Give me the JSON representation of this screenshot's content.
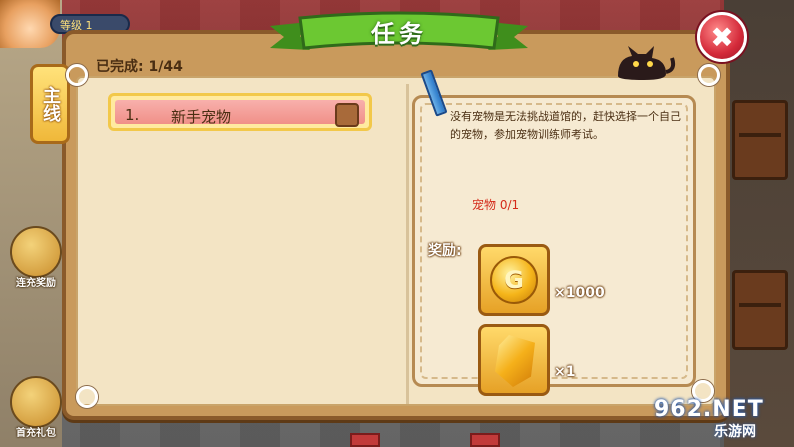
{
  "game": {
    "top_bar_text": "等级 1"
  },
  "dialog": {
    "title": "任务",
    "close_symbol": "✖",
    "completed_text": "已完成: 1/44",
    "main_tab_label": "主线"
  },
  "quests": [
    {
      "number": "1.",
      "name": "新手宠物",
      "selected": true
    }
  ],
  "detail": {
    "description": "没有宠物是无法挑战道馆的，赶快选择一个自己的宠物，参加宠物训练师考试。",
    "progress": "宠物 0/1",
    "reward_label": "奖励:",
    "rewards": [
      {
        "icon": "gold-coin-icon",
        "symbol": "G",
        "quantity": "×1000"
      },
      {
        "icon": "topaz-gem-icon",
        "quantity": "×1"
      }
    ]
  },
  "side_buttons": [
    {
      "label": "连充奖励",
      "icon": "treasure-pile-icon"
    },
    {
      "label": "首充礼包",
      "icon": "gift-pack-icon"
    }
  ],
  "watermark": {
    "main": "962.NET",
    "sub": "乐游网"
  },
  "colors": {
    "ribbon_green": "#5cb82a",
    "close_red": "#d42a3a",
    "panel_brown": "#c99a5c",
    "paper": "#f3e4c4",
    "quest_row_pink": "#f09088",
    "progress_red": "#d42a1a"
  }
}
